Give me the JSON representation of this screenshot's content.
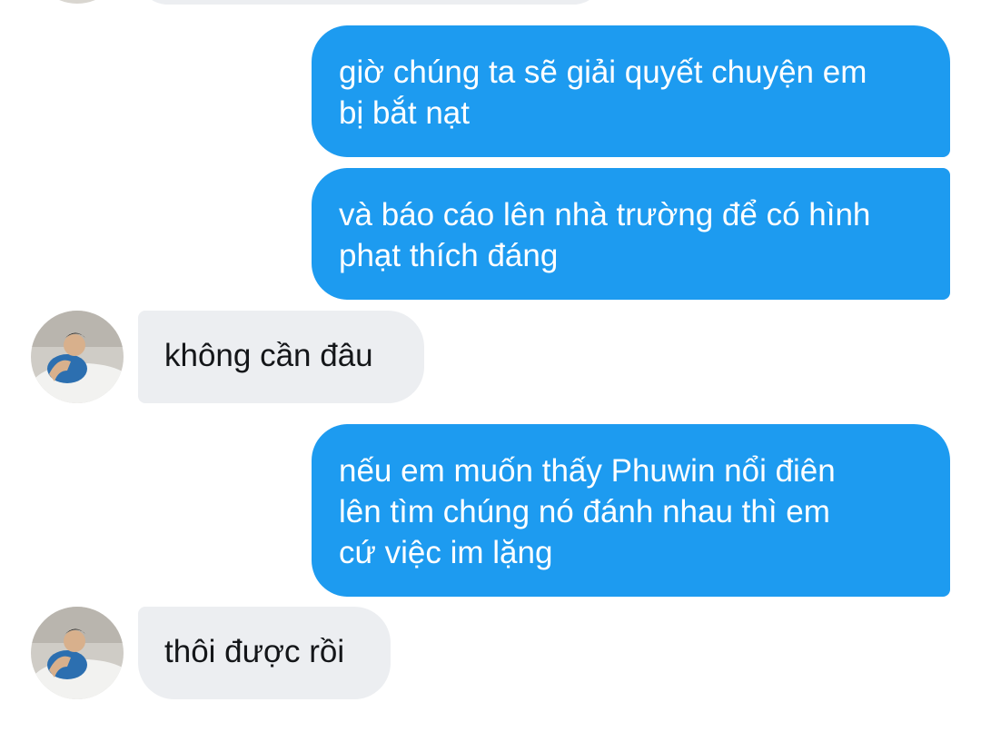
{
  "conversation": {
    "messages": [
      {
        "sender": "contact",
        "lines": []
      },
      {
        "sender": "me",
        "lines": [
          "giờ chúng ta sẽ giải quyết chuyện em",
          "bị bắt nạt"
        ]
      },
      {
        "sender": "me",
        "lines": [
          "và báo cáo lên nhà trường để có hình",
          "phạt thích đáng"
        ]
      },
      {
        "sender": "contact",
        "lines": [
          "không cần đâu"
        ]
      },
      {
        "sender": "me",
        "lines": [
          "nếu em muốn thấy Phuwin nổi điên",
          "lên tìm chúng nó đánh nhau thì em",
          "cứ việc im lặng"
        ]
      },
      {
        "sender": "contact",
        "lines": [
          "thôi được rồi"
        ]
      }
    ]
  },
  "theme": {
    "sent_bubble_color": "#1d9bf0",
    "received_bubble_color": "#eceef1",
    "background_color": "#ffffff"
  },
  "icons": {
    "contact_avatar": "contact-avatar-photo"
  }
}
